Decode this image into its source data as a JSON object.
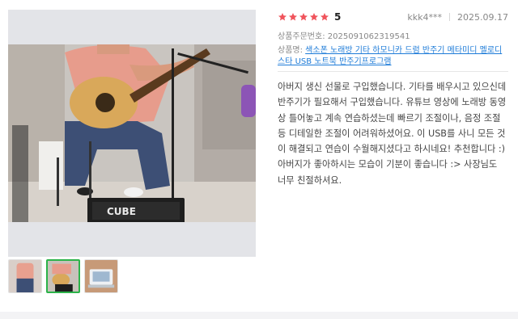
{
  "review": {
    "rating": {
      "stars_filled": 5,
      "stars_total": 5,
      "value_label": "5",
      "star_color": "#f0545c"
    },
    "user": "kkk4***",
    "date": "2025.09.17",
    "order": {
      "label": "상품주문번호:",
      "number": "2025091062319541"
    },
    "product": {
      "label": "상품명:",
      "name": "색소폰 노래방 기타 하모니카 드럼 반주기 메타미디 멜로디스타 USB 노트북 반주기프로그램",
      "link_color": "#1d7bd8"
    },
    "body": "아버지 생신 선물로 구입했습니다. 기타를 배우시고 있으신데 반주기가 필요해서 구입했습니다. 유튜브 영상에 노래방 동영상 틀어놓고 계속 연습하셨는데 빠르기 조절이나, 음정 조절 등 디테일한 조절이 어려워하셨어요. 이 USB를 사니 모든 것이 해결되고 연습이 수월해지셨다고 하시네요! 추천합니다 :) 아버지가 좋아하시는 모습이 기분이 좋습니다 :> 사장님도 너무 친절하셔요."
  },
  "photos": {
    "main": {
      "description_icon": "guitar-player-photo",
      "amp_brand": "CUBE"
    },
    "thumbnails": [
      {
        "name": "thumb-1",
        "active": false
      },
      {
        "name": "thumb-2",
        "active": true
      },
      {
        "name": "thumb-3",
        "active": false
      }
    ],
    "active_border_color": "#2cb34a"
  }
}
